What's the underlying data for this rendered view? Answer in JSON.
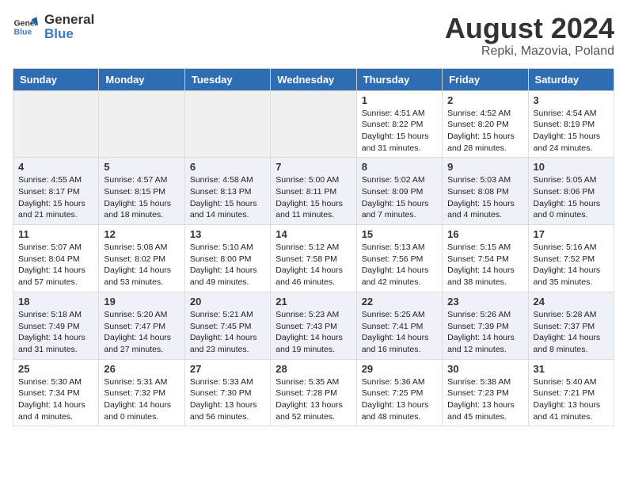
{
  "header": {
    "logo_general": "General",
    "logo_blue": "Blue",
    "month_year": "August 2024",
    "location": "Repki, Mazovia, Poland"
  },
  "weekdays": [
    "Sunday",
    "Monday",
    "Tuesday",
    "Wednesday",
    "Thursday",
    "Friday",
    "Saturday"
  ],
  "weeks": [
    [
      {
        "day": "",
        "info": ""
      },
      {
        "day": "",
        "info": ""
      },
      {
        "day": "",
        "info": ""
      },
      {
        "day": "",
        "info": ""
      },
      {
        "day": "1",
        "info": "Sunrise: 4:51 AM\nSunset: 8:22 PM\nDaylight: 15 hours\nand 31 minutes."
      },
      {
        "day": "2",
        "info": "Sunrise: 4:52 AM\nSunset: 8:20 PM\nDaylight: 15 hours\nand 28 minutes."
      },
      {
        "day": "3",
        "info": "Sunrise: 4:54 AM\nSunset: 8:19 PM\nDaylight: 15 hours\nand 24 minutes."
      }
    ],
    [
      {
        "day": "4",
        "info": "Sunrise: 4:55 AM\nSunset: 8:17 PM\nDaylight: 15 hours\nand 21 minutes."
      },
      {
        "day": "5",
        "info": "Sunrise: 4:57 AM\nSunset: 8:15 PM\nDaylight: 15 hours\nand 18 minutes."
      },
      {
        "day": "6",
        "info": "Sunrise: 4:58 AM\nSunset: 8:13 PM\nDaylight: 15 hours\nand 14 minutes."
      },
      {
        "day": "7",
        "info": "Sunrise: 5:00 AM\nSunset: 8:11 PM\nDaylight: 15 hours\nand 11 minutes."
      },
      {
        "day": "8",
        "info": "Sunrise: 5:02 AM\nSunset: 8:09 PM\nDaylight: 15 hours\nand 7 minutes."
      },
      {
        "day": "9",
        "info": "Sunrise: 5:03 AM\nSunset: 8:08 PM\nDaylight: 15 hours\nand 4 minutes."
      },
      {
        "day": "10",
        "info": "Sunrise: 5:05 AM\nSunset: 8:06 PM\nDaylight: 15 hours\nand 0 minutes."
      }
    ],
    [
      {
        "day": "11",
        "info": "Sunrise: 5:07 AM\nSunset: 8:04 PM\nDaylight: 14 hours\nand 57 minutes."
      },
      {
        "day": "12",
        "info": "Sunrise: 5:08 AM\nSunset: 8:02 PM\nDaylight: 14 hours\nand 53 minutes."
      },
      {
        "day": "13",
        "info": "Sunrise: 5:10 AM\nSunset: 8:00 PM\nDaylight: 14 hours\nand 49 minutes."
      },
      {
        "day": "14",
        "info": "Sunrise: 5:12 AM\nSunset: 7:58 PM\nDaylight: 14 hours\nand 46 minutes."
      },
      {
        "day": "15",
        "info": "Sunrise: 5:13 AM\nSunset: 7:56 PM\nDaylight: 14 hours\nand 42 minutes."
      },
      {
        "day": "16",
        "info": "Sunrise: 5:15 AM\nSunset: 7:54 PM\nDaylight: 14 hours\nand 38 minutes."
      },
      {
        "day": "17",
        "info": "Sunrise: 5:16 AM\nSunset: 7:52 PM\nDaylight: 14 hours\nand 35 minutes."
      }
    ],
    [
      {
        "day": "18",
        "info": "Sunrise: 5:18 AM\nSunset: 7:49 PM\nDaylight: 14 hours\nand 31 minutes."
      },
      {
        "day": "19",
        "info": "Sunrise: 5:20 AM\nSunset: 7:47 PM\nDaylight: 14 hours\nand 27 minutes."
      },
      {
        "day": "20",
        "info": "Sunrise: 5:21 AM\nSunset: 7:45 PM\nDaylight: 14 hours\nand 23 minutes."
      },
      {
        "day": "21",
        "info": "Sunrise: 5:23 AM\nSunset: 7:43 PM\nDaylight: 14 hours\nand 19 minutes."
      },
      {
        "day": "22",
        "info": "Sunrise: 5:25 AM\nSunset: 7:41 PM\nDaylight: 14 hours\nand 16 minutes."
      },
      {
        "day": "23",
        "info": "Sunrise: 5:26 AM\nSunset: 7:39 PM\nDaylight: 14 hours\nand 12 minutes."
      },
      {
        "day": "24",
        "info": "Sunrise: 5:28 AM\nSunset: 7:37 PM\nDaylight: 14 hours\nand 8 minutes."
      }
    ],
    [
      {
        "day": "25",
        "info": "Sunrise: 5:30 AM\nSunset: 7:34 PM\nDaylight: 14 hours\nand 4 minutes."
      },
      {
        "day": "26",
        "info": "Sunrise: 5:31 AM\nSunset: 7:32 PM\nDaylight: 14 hours\nand 0 minutes."
      },
      {
        "day": "27",
        "info": "Sunrise: 5:33 AM\nSunset: 7:30 PM\nDaylight: 13 hours\nand 56 minutes."
      },
      {
        "day": "28",
        "info": "Sunrise: 5:35 AM\nSunset: 7:28 PM\nDaylight: 13 hours\nand 52 minutes."
      },
      {
        "day": "29",
        "info": "Sunrise: 5:36 AM\nSunset: 7:25 PM\nDaylight: 13 hours\nand 48 minutes."
      },
      {
        "day": "30",
        "info": "Sunrise: 5:38 AM\nSunset: 7:23 PM\nDaylight: 13 hours\nand 45 minutes."
      },
      {
        "day": "31",
        "info": "Sunrise: 5:40 AM\nSunset: 7:21 PM\nDaylight: 13 hours\nand 41 minutes."
      }
    ]
  ]
}
